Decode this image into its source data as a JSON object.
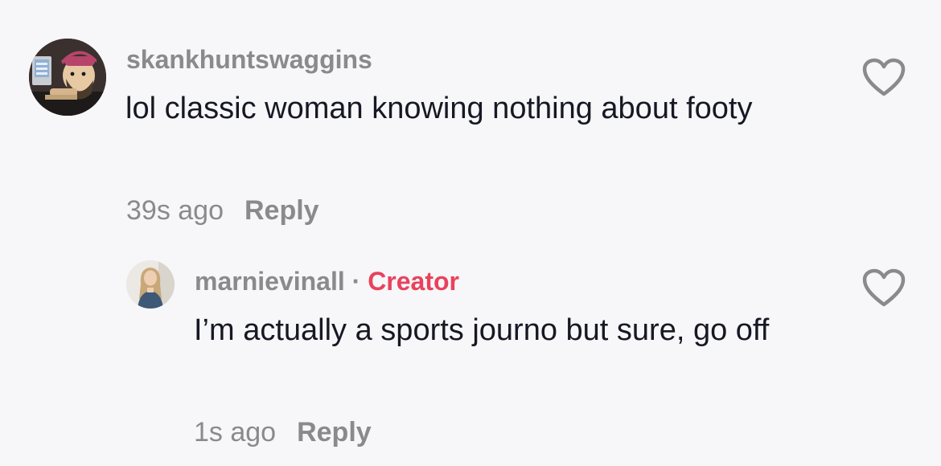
{
  "comments": [
    {
      "username": "skankhuntswaggins",
      "text": "lol classic woman knowing nothing about footy",
      "timestamp": "39s ago",
      "reply_label": "Reply"
    }
  ],
  "replies": [
    {
      "username": "marnievinall",
      "separator": "·",
      "badge": "Creator",
      "text": "I’m actually a sports journo but sure, go off",
      "timestamp": "1s ago",
      "reply_label": "Reply"
    }
  ],
  "colors": {
    "background": "#f7f6f8",
    "username": "#8a8a8e",
    "text": "#161823",
    "creator_badge": "#e8425d",
    "heart_outline": "#8a8a8e"
  },
  "icons": {
    "like": "heart-outline-icon"
  }
}
